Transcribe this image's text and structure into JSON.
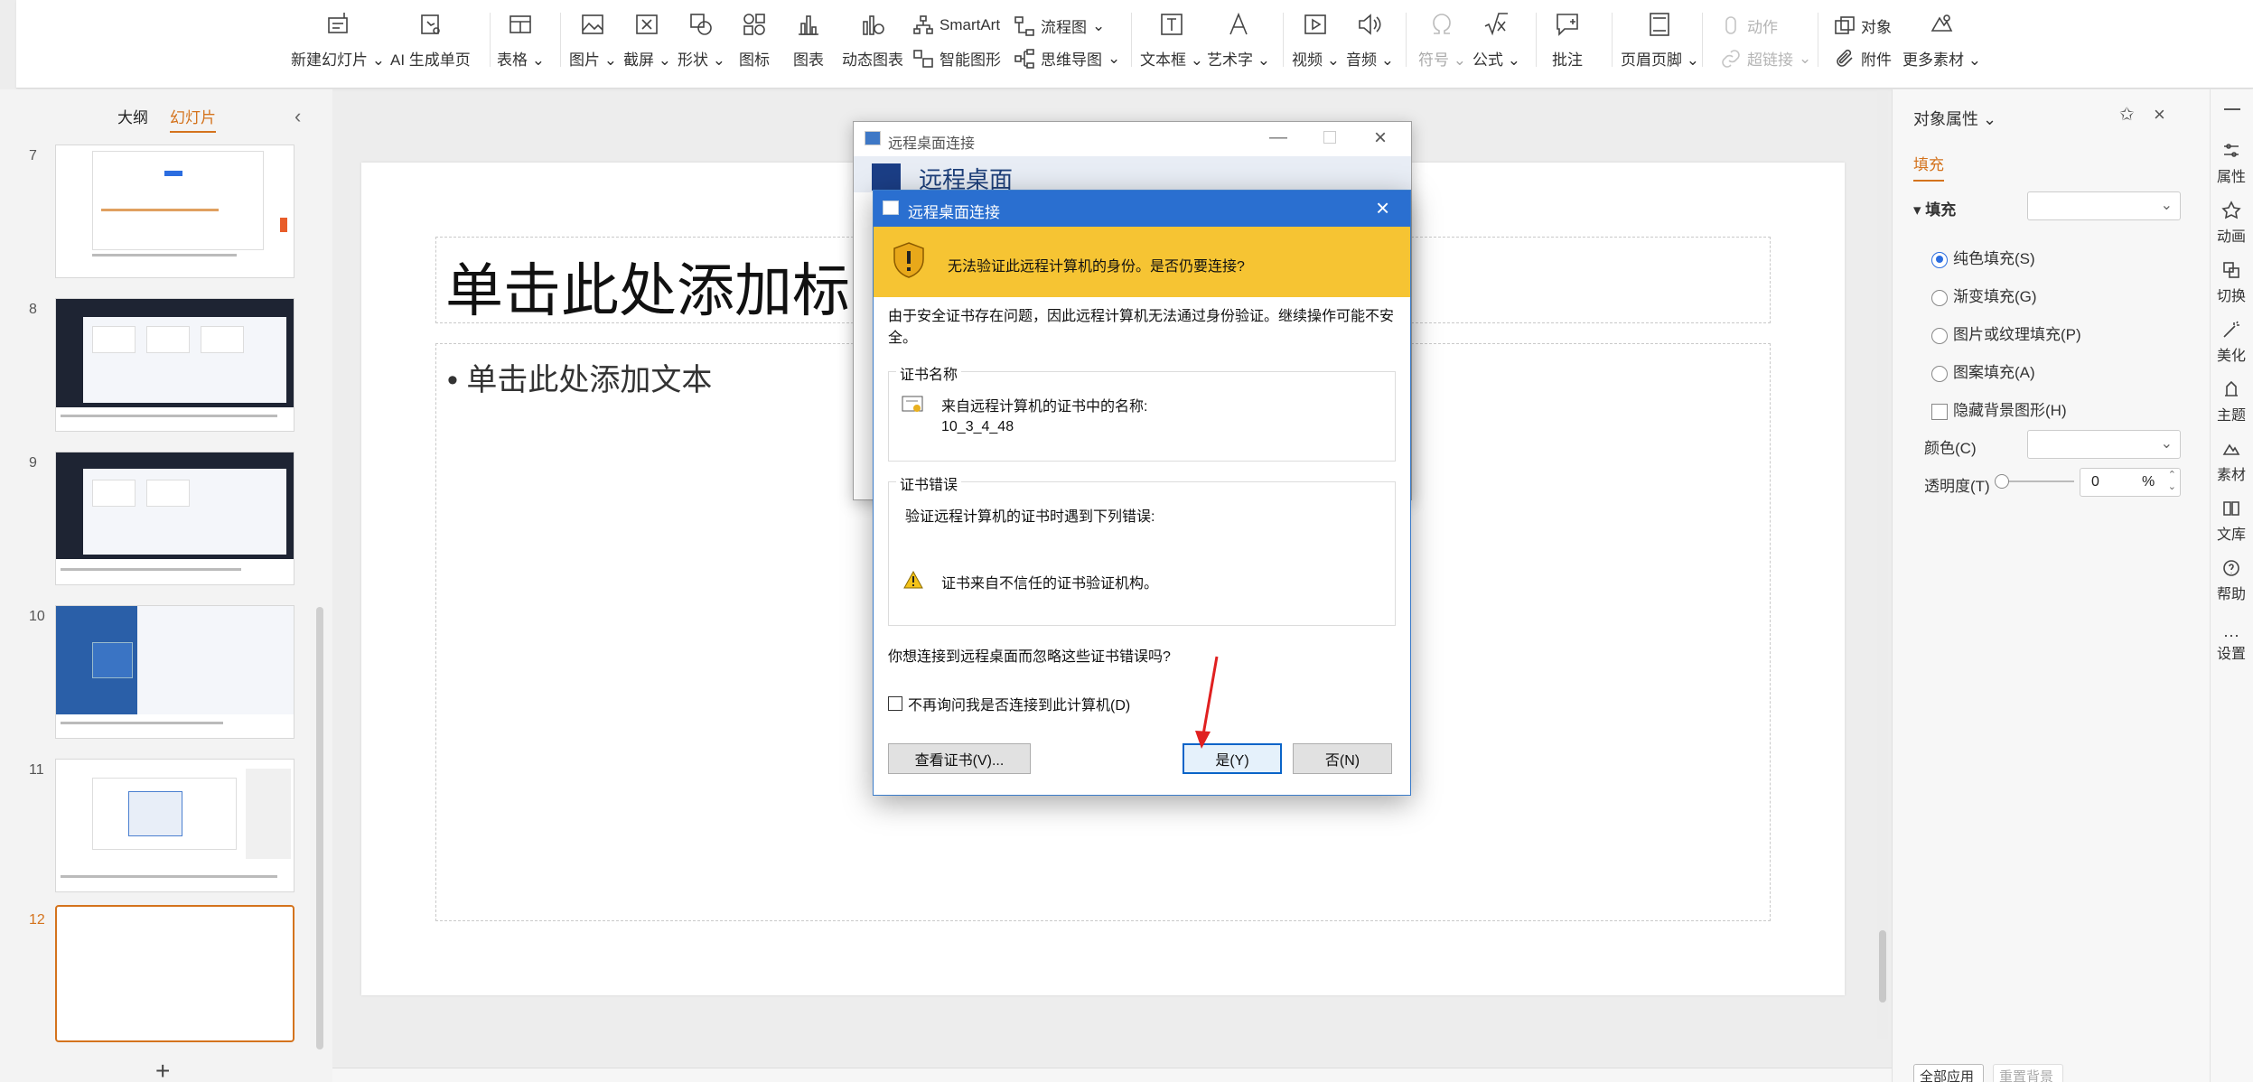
{
  "ribbon": {
    "new_slide": "新建幻灯片",
    "ai_page": "AI 生成单页",
    "table": "表格",
    "picture": "图片",
    "screenshot": "截屏",
    "shape": "形状",
    "icon": "图标",
    "chart": "图表",
    "dynamic_chart": "动态图表",
    "smartart": "SmartArt",
    "smart_shape": "智能图形",
    "flowchart": "流程图",
    "mindmap": "思维导图",
    "textbox": "文本框",
    "wordart": "艺术字",
    "video": "视频",
    "audio": "音频",
    "symbol": "符号",
    "formula": "公式",
    "comment": "批注",
    "header_footer": "页眉页脚",
    "action": "动作",
    "hyperlink": "超链接",
    "object": "对象",
    "attachment": "附件",
    "more_material": "更多素材"
  },
  "left_panel": {
    "tab_outline": "大纲",
    "tab_slides": "幻灯片",
    "slide_numbers": [
      "7",
      "8",
      "9",
      "10",
      "11",
      "12"
    ],
    "add_slide": "+"
  },
  "slide": {
    "title_placeholder": "单击此处添加标",
    "body_placeholder": "单击此处添加文本"
  },
  "right_panel": {
    "title": "对象属性",
    "tab_fill": "填充",
    "section_fill": "填充",
    "opt_solid": "纯色填充(S)",
    "opt_gradient": "渐变填充(G)",
    "opt_picture": "图片或纹理填充(P)",
    "opt_pattern": "图案填充(A)",
    "opt_hide_bg": "隐藏背景图形(H)",
    "color_label": "颜色(C)",
    "transparency_label": "透明度(T)",
    "transparency_value": "0",
    "transparency_unit": "%",
    "apply_all": "全部应用",
    "reset_bg": "重置背景"
  },
  "right_sidebar": [
    "属性",
    "动画",
    "切换",
    "美化",
    "主题",
    "素材",
    "文库",
    "帮助",
    "设置"
  ],
  "back_dialog": {
    "title": "远程桌面连接",
    "heading": "远程桌面"
  },
  "dialog": {
    "title": "远程桌面连接",
    "warning": "无法验证此远程计算机的身份。是否仍要连接?",
    "description": "由于安全证书存在问题，因此远程计算机无法通过身份验证。继续操作可能不安全。",
    "cert_name_label": "证书名称",
    "cert_name_desc": "来自远程计算机的证书中的名称:",
    "cert_name_value": "10_3_4_48",
    "cert_error_label": "证书错误",
    "cert_error_desc": "验证远程计算机的证书时遇到下列错误:",
    "cert_error_item": "证书来自不信任的证书验证机构。",
    "question": "你想连接到远程桌面而忽略这些证书错误吗?",
    "dont_ask": "不再询问我是否连接到此计算机(D)",
    "view_cert": "查看证书(V)...",
    "yes": "是(Y)",
    "no": "否(N)"
  },
  "colors": {
    "accent": "#d4731d",
    "warning_band": "#f6c433",
    "dialog_title": "#2a6fd0",
    "arrow": "#e02020"
  }
}
